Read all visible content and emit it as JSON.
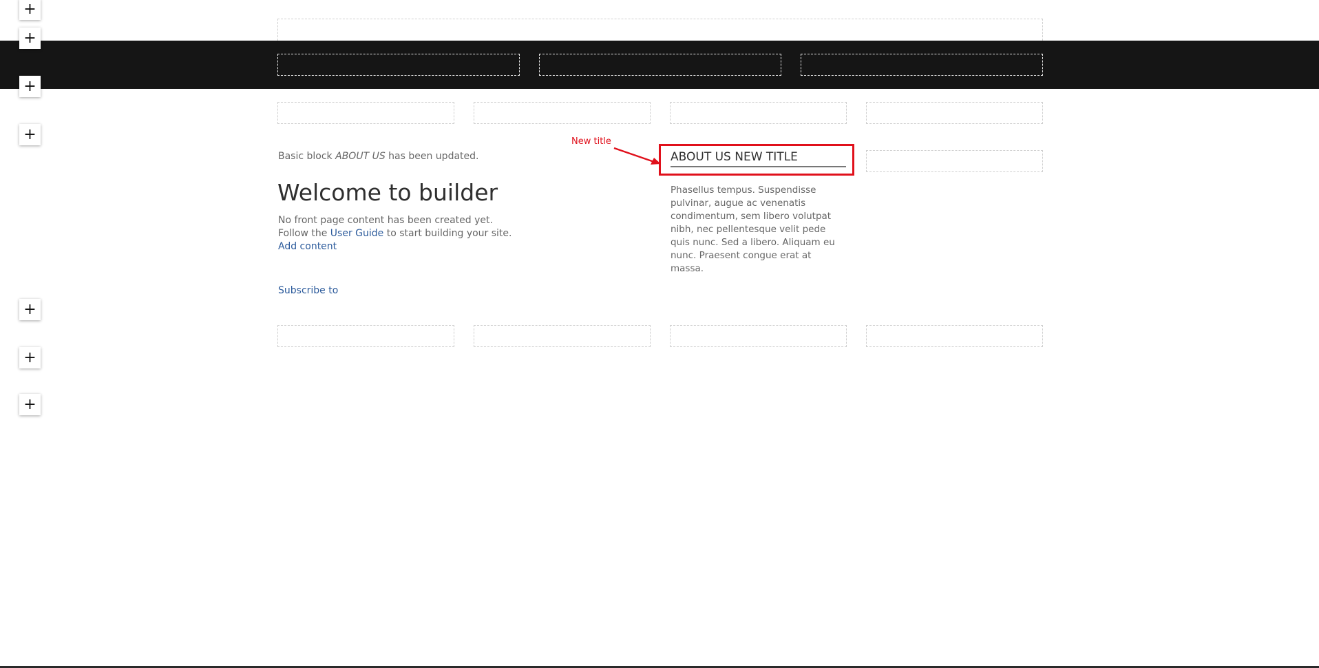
{
  "toolbar": {
    "add_buttons": [
      "+",
      "+",
      "+",
      "+",
      "+",
      "+",
      "+"
    ]
  },
  "status": {
    "prefix": "Basic block",
    "block_name": "ABOUT US",
    "suffix": "has been updated."
  },
  "main": {
    "heading": "Welcome to builder",
    "line1": "No front page content has been created yet.",
    "line2_prefix": "Follow the",
    "user_guide_link": "User Guide",
    "line2_suffix": "to start building your site.",
    "add_content_link": "Add content",
    "subscribe_link": "Subscribe to"
  },
  "about_block": {
    "title": "ABOUT US NEW TITLE",
    "body": "Phasellus tempus. Suspendisse pulvinar, augue ac venenatis condimentum, sem libero volutpat nibh, nec pellentesque velit pede quis nunc. Sed a libero. Aliquam eu nunc. Praesent congue erat at massa."
  },
  "annotation": {
    "label": "New title",
    "color": "#e0101b"
  },
  "colors": {
    "dark_band": "#151515",
    "link": "#2b5a9b",
    "highlight": "#e0101b"
  }
}
